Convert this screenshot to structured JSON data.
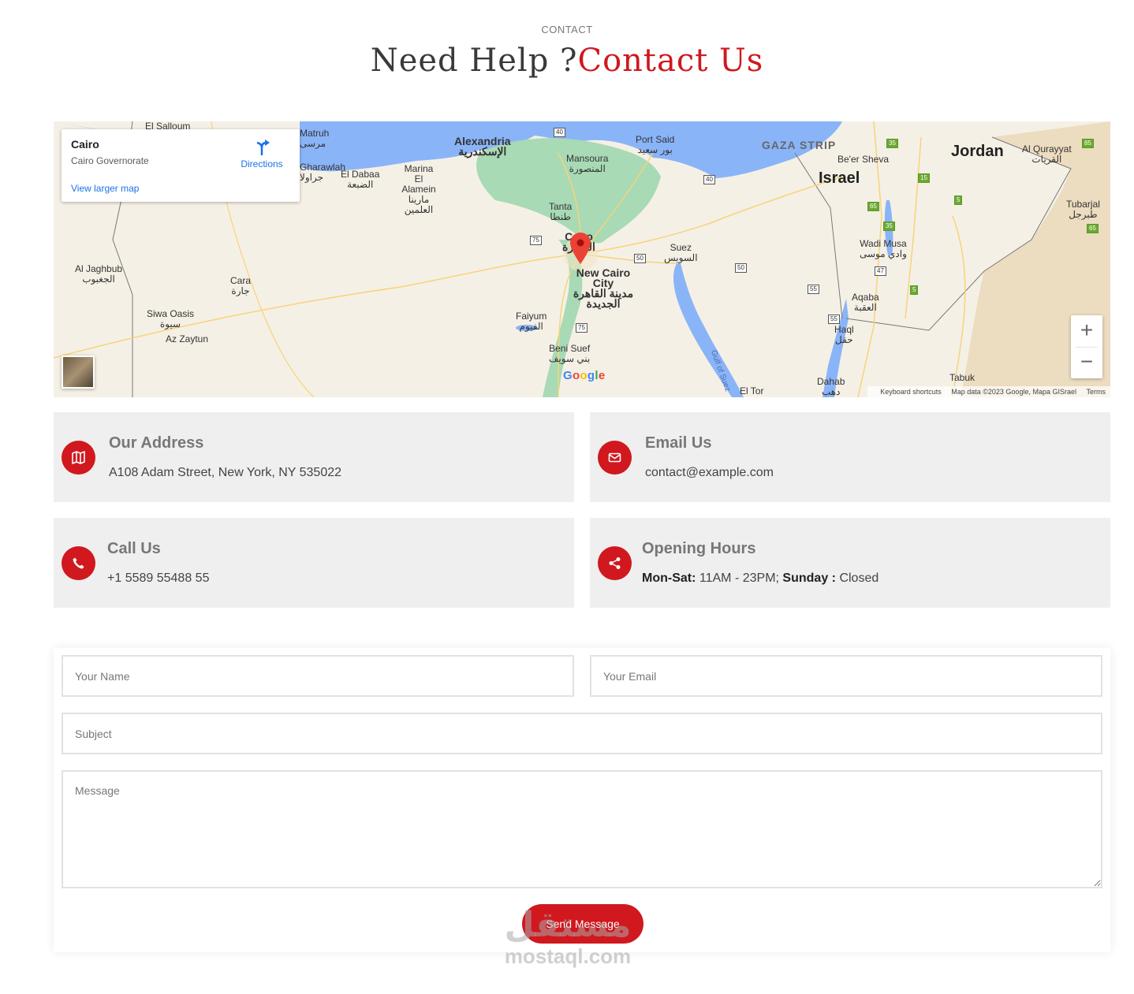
{
  "header": {
    "eyebrow": "CONTACT",
    "title_part1": "Need Help ?",
    "title_part2": "Contact Us"
  },
  "map": {
    "card": {
      "place": "Cairo",
      "region": "Cairo Governorate",
      "directions_label": "Directions",
      "larger_map_label": "View larger map"
    },
    "labels": {
      "alexandria": "Alexandria",
      "alexandria_ar": "الإسكندرية",
      "port_said": "Port Said",
      "port_said_ar": "بور سعيد",
      "mansoura": "Mansoura",
      "mansoura_ar": "المنصورة",
      "tanta": "Tanta",
      "tanta_ar": "طنطا",
      "cairo": "Cairo",
      "cairo_ar": "القاهرة",
      "suez": "Suez",
      "suez_ar": "السويس",
      "new_cairo": "New Cairo City",
      "new_cairo_ar": "مدينة القاهرة الجديدة",
      "faiyum": "Faiyum",
      "faiyum_ar": "الفيوم",
      "beni_suef": "Beni Suef",
      "beni_suef_ar": "بني سويف",
      "el_dabaa": "El Dabaa",
      "el_dabaa_ar": "الضبعة",
      "marina": "Marina El Alamein",
      "marina_ar": "مارينا العلمين",
      "gaza": "GAZA STRIP",
      "beer_sheva": "Be'er Sheva",
      "israel": "Israel",
      "jordan": "Jordan",
      "al_qurayyat": "Al Qurayyat",
      "al_qurayyat_ar": "القريات",
      "tubarjal": "Tubarjal",
      "tubarjal_ar": "طبرجل",
      "wadi_musa": "Wadi Musa",
      "wadi_musa_ar": "وادي موسى",
      "aqaba": "Aqaba",
      "aqaba_ar": "العقبة",
      "haql": "Haql",
      "haql_ar": "حقل",
      "dahab": "Dahab",
      "dahab_ar": "دهب",
      "el_tor": "El Tor",
      "tabuk": "Tabuk",
      "al_jaghbub": "Al Jaghbub",
      "al_jaghbub_ar": "الجغبوب",
      "cara": "Cara",
      "cara_ar": "جارة",
      "siwa": "Siwa Oasis",
      "siwa_ar": "سيوة",
      "az_zaytun": "Az Zaytun",
      "el_salloum": "El Salloum",
      "matruh": "Matruh",
      "matruh_ar": "مرسى",
      "gharawlah": "Gharawlah",
      "gharawlah_ar": "جراولا",
      "gulf_of_suez": "Gulf of Suez"
    },
    "road_numbers": [
      "40",
      "40",
      "75",
      "50",
      "50",
      "55",
      "55",
      "47",
      "35",
      "15",
      "65",
      "35",
      "5",
      "5",
      "75",
      "85",
      "65"
    ],
    "google_logo": "Google",
    "attribution": {
      "shortcuts": "Keyboard shortcuts",
      "map_data": "Map data ©2023 Google, Mapa GISrael",
      "terms": "Terms"
    },
    "zoom_in": "+",
    "zoom_out": "−"
  },
  "info": {
    "address": {
      "heading": "Our Address",
      "value": "A108 Adam Street, New York, NY 535022",
      "icon": "map-icon"
    },
    "email": {
      "heading": "Email Us",
      "value": "contact@example.com",
      "icon": "envelope-icon"
    },
    "call": {
      "heading": "Call Us",
      "value": "+1 5589 55488 55",
      "icon": "phone-icon"
    },
    "hours": {
      "heading": "Opening Hours",
      "days1": "Mon-Sat:",
      "time1": "11AM - 23PM;",
      "days2": "Sunday :",
      "time2": "Closed",
      "icon": "share-icon"
    }
  },
  "form": {
    "name_placeholder": "Your Name",
    "email_placeholder": "Your Email",
    "subject_placeholder": "Subject",
    "message_placeholder": "Message",
    "send_label": "Send Message"
  },
  "watermark": {
    "arabic": "مستقل",
    "latin": "mostaql.com"
  },
  "colors": {
    "accent": "#d0181e",
    "card_bg": "#efefef",
    "link": "#1a73e8",
    "water": "#8ab4f8",
    "green": "#a8dab5"
  }
}
